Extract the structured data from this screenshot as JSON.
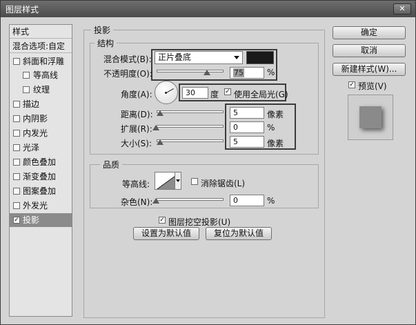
{
  "window": {
    "title": "图层样式",
    "close_glyph": "✕"
  },
  "styles_list": {
    "header": "样式",
    "blend_options": "混合选项:自定",
    "items": [
      {
        "label": "斜面和浮雕",
        "checked": false
      },
      {
        "label": "等高线",
        "checked": false
      },
      {
        "label": "纹理",
        "checked": false
      },
      {
        "label": "描边",
        "checked": false
      },
      {
        "label": "内阴影",
        "checked": false
      },
      {
        "label": "内发光",
        "checked": false
      },
      {
        "label": "光泽",
        "checked": false
      },
      {
        "label": "颜色叠加",
        "checked": false
      },
      {
        "label": "渐变叠加",
        "checked": false
      },
      {
        "label": "图案叠加",
        "checked": false
      },
      {
        "label": "外发光",
        "checked": false
      },
      {
        "label": "投影",
        "checked": true
      }
    ]
  },
  "panel": {
    "title": "投影",
    "structure": {
      "legend": "结构",
      "blend_mode_label": "混合模式(B):",
      "blend_mode_value": "正片叠底",
      "swatch_color": "#1a1a1a",
      "opacity_label": "不透明度(O):",
      "opacity_value": "75",
      "opacity_level": 75,
      "percent": "%",
      "angle_label": "角度(A):",
      "angle_value": "30",
      "degree_unit": "度",
      "global_light_label": "使用全局光(G)",
      "global_light_checked": true,
      "distance_label": "距离(D):",
      "distance_value": "5",
      "pixels_unit": "像素",
      "spread_label": "扩展(R):",
      "spread_value": "0",
      "size_label": "大小(S):",
      "size_value": "5"
    },
    "quality": {
      "legend": "品质",
      "contour_label": "等高线:",
      "antialias_label": "消除锯齿(L)",
      "antialias_checked": false,
      "noise_label": "杂色(N):",
      "noise_value": "0",
      "knockout_label": "图层挖空投影(U)",
      "knockout_checked": true
    },
    "reset_default_btn": "设置为默认值",
    "restore_default_btn": "复位为默认值"
  },
  "right": {
    "ok": "确定",
    "cancel": "取消",
    "new_style": "新建样式(W)...",
    "preview_label": "预览(V)",
    "preview_checked": true
  },
  "check_glyph": "✓"
}
